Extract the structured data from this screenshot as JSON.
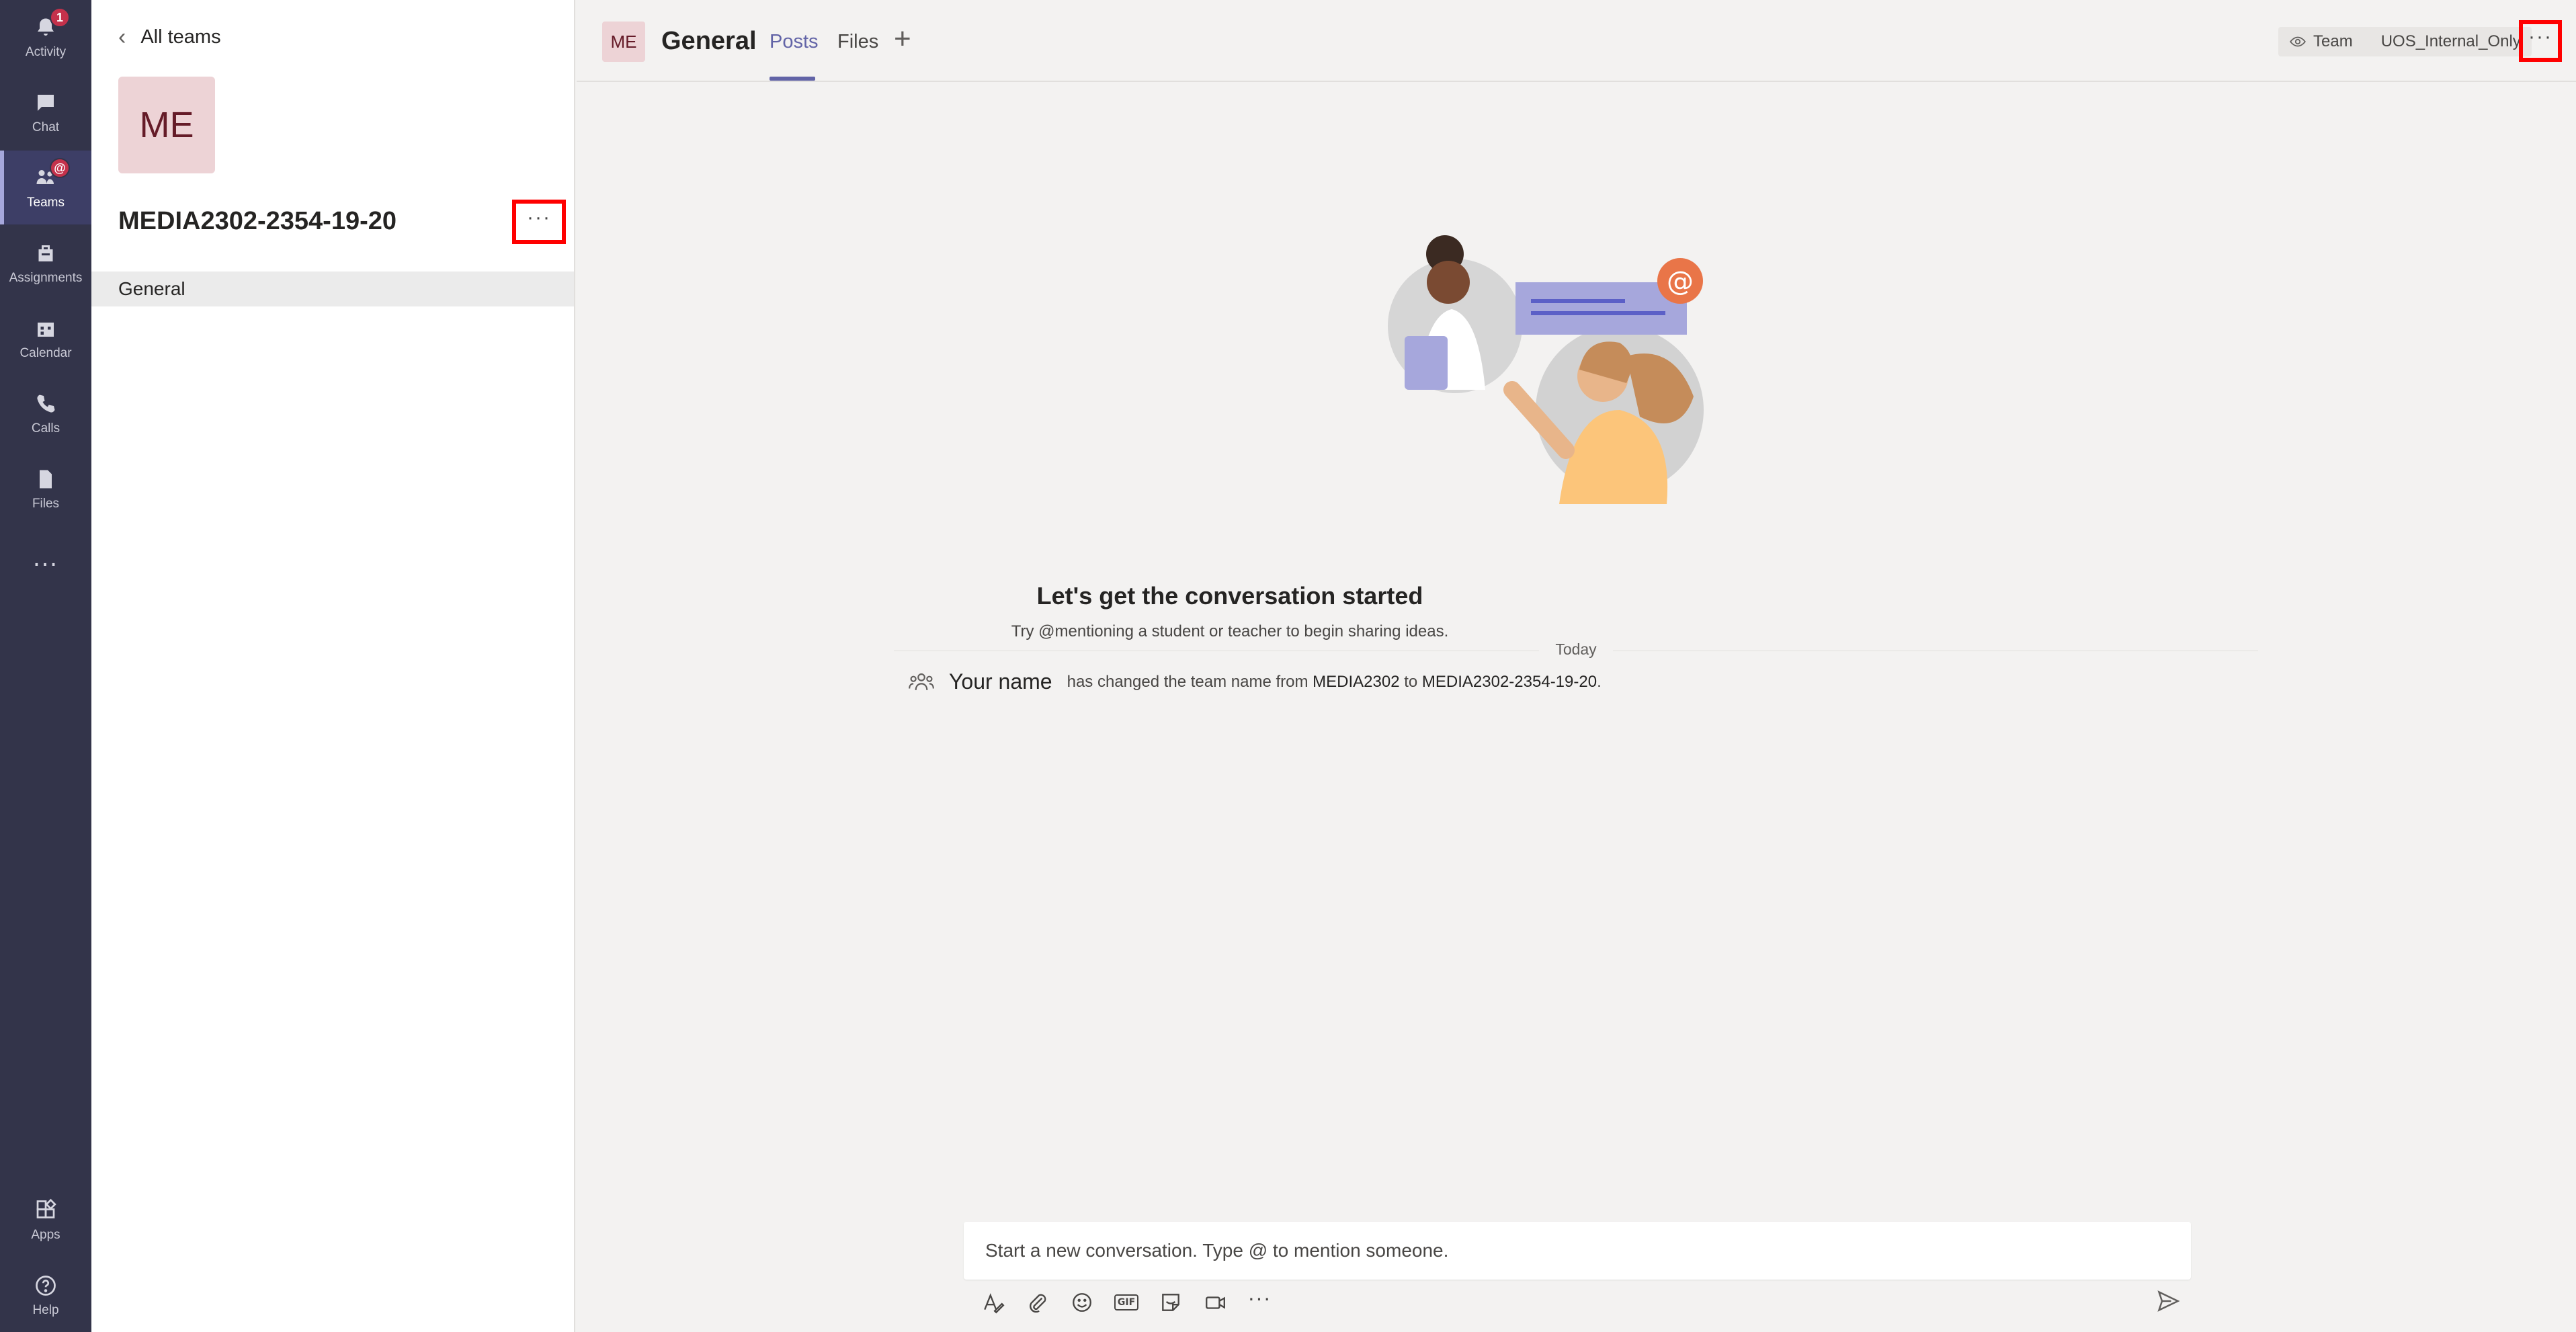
{
  "rail": {
    "items": [
      {
        "label": "Activity",
        "badge": "1",
        "icon": "bell-icon"
      },
      {
        "label": "Chat",
        "icon": "chat-icon"
      },
      {
        "label": "Teams",
        "icon": "teams-icon",
        "badge_icon": "mention-icon"
      },
      {
        "label": "Assignments",
        "icon": "assignments-icon"
      },
      {
        "label": "Calendar",
        "icon": "calendar-icon"
      },
      {
        "label": "Calls",
        "icon": "phone-icon"
      },
      {
        "label": "Files",
        "icon": "file-icon"
      },
      {
        "label": "...",
        "icon": "more-icon"
      },
      {
        "label": "Apps",
        "icon": "apps-icon"
      },
      {
        "label": "Help",
        "icon": "help-icon"
      }
    ]
  },
  "team_panel": {
    "back_label": "All teams",
    "avatar_initials": "ME",
    "team_name": "MEDIA2302-2354-19-20",
    "more_label": "···",
    "channels": [
      {
        "label": "General"
      }
    ]
  },
  "channel_header": {
    "avatar_initials": "ME",
    "title": "General",
    "tabs": [
      {
        "label": "Posts",
        "active": true
      },
      {
        "label": "Files",
        "active": false
      }
    ],
    "add_tab": "+",
    "visibility_label": "Team",
    "classification_label": "UOS_Internal_Only",
    "more_label": "···"
  },
  "conversation": {
    "title": "Let's get the conversation started",
    "subtitle": "Try @mentioning a student or teacher to begin sharing ideas.",
    "date_divider": "Today",
    "event": {
      "who": "Your name",
      "text_1": "has changed the team name from",
      "old_name": "MEDIA2302",
      "text_2": "to",
      "new_name": "MEDIA2302-2354-19-20",
      "text_3": "."
    }
  },
  "composer": {
    "placeholder": "Start a new conversation. Type @ to mention someone.",
    "gif_label": "GIF",
    "more_label": "···"
  },
  "colors": {
    "rail_bg": "#33344a",
    "accent": "#6264a7",
    "highlight_box": "#ff0000",
    "avatar_bg": "#edd3d6",
    "avatar_text": "#651b28"
  }
}
